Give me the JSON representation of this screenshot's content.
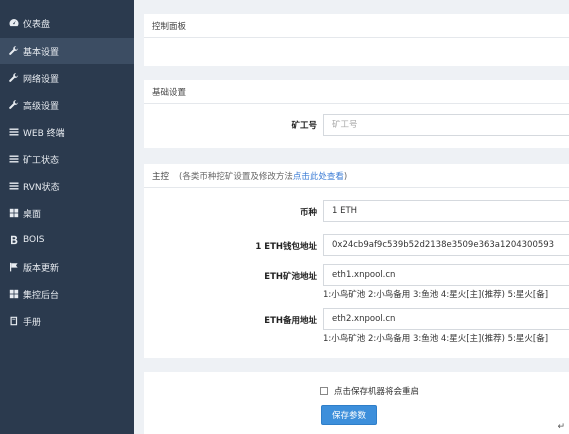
{
  "sidebar": {
    "items": [
      {
        "label": "仪表盘",
        "icon": "dashboard-icon"
      },
      {
        "label": "基本设置",
        "icon": "wrench-icon"
      },
      {
        "label": "网络设置",
        "icon": "wrench-icon"
      },
      {
        "label": "高级设置",
        "icon": "wrench-icon"
      },
      {
        "label": "WEB 终端",
        "icon": "list-icon"
      },
      {
        "label": "矿工状态",
        "icon": "list-icon"
      },
      {
        "label": "RVN状态",
        "icon": "list-icon"
      },
      {
        "label": "桌面",
        "icon": "grid-icon"
      },
      {
        "label": "BOIS",
        "icon": "bold-b-icon"
      },
      {
        "label": "版本更新",
        "icon": "flag-icon"
      },
      {
        "label": "集控后台",
        "icon": "grid-icon"
      },
      {
        "label": "手册",
        "icon": "book-icon"
      }
    ],
    "active_index": 1
  },
  "control_panel": {
    "title": "控制面板"
  },
  "basic": {
    "title": "基础设置",
    "worker_label": "矿工号",
    "worker_placeholder": "矿工号"
  },
  "main_ctrl": {
    "title": "主控",
    "hint_prefix": "(各类币种挖矿设置及修改方法",
    "hint_link": "点击此处查看",
    "hint_suffix": ")",
    "coin_label": "币种",
    "coin_value": "1 ETH",
    "wallet_label": "1 ETH钱包地址",
    "wallet_value": "0x24cb9af9c539b52d2138e3509e363a1204300593",
    "pool_label": "ETH矿池地址",
    "pool_value": "eth1.xnpool.cn",
    "pool_options": "1:小鸟矿池 2:小鸟备用 3:鱼池 4:星火[主](推荐) 5:星火[备]",
    "backup_label": "ETH备用地址",
    "backup_value": "eth2.xnpool.cn",
    "backup_options": "1:小鸟矿池 2:小鸟备用 3:鱼池 4:星火[主](推荐) 5:星火[备]"
  },
  "footer": {
    "reboot_label": "点击保存机器将会重启",
    "save_label": "保存参数"
  },
  "return_mark": "↵"
}
